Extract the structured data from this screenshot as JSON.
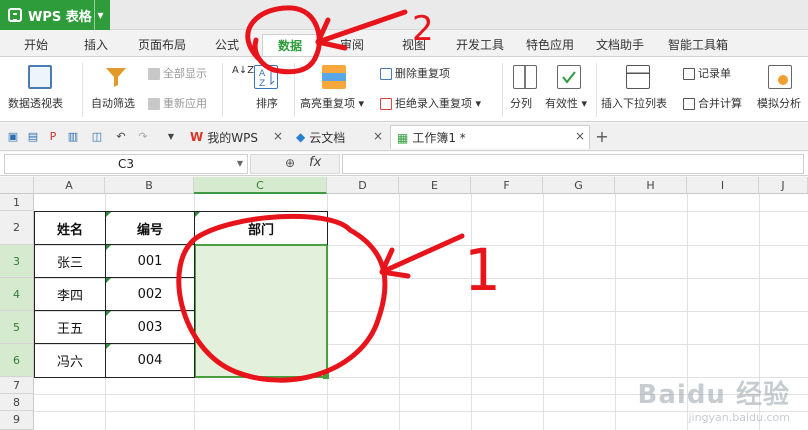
{
  "app": {
    "title": "WPS 表格",
    "brand_color": "#2f9c3c"
  },
  "ribbon_tabs": [
    {
      "label": "开始"
    },
    {
      "label": "插入"
    },
    {
      "label": "页面布局"
    },
    {
      "label": "公式"
    },
    {
      "label": "数据",
      "active": true
    },
    {
      "label": "审阅"
    },
    {
      "label": "视图"
    },
    {
      "label": "开发工具"
    },
    {
      "label": "特色应用"
    },
    {
      "label": "文档助手"
    },
    {
      "label": "智能工具箱"
    }
  ],
  "ribbon": {
    "pivot_table": "数据透视表",
    "auto_filter": "自动筛选",
    "show_all": "全部显示",
    "reapply": "重新应用",
    "sort_az": "A↓Z",
    "sort": "排序",
    "highlight_dup": "高亮重复项",
    "remove_dup": "删除重复项",
    "reject_dup": "拒绝录入重复项",
    "split": "分列",
    "validity": "有效性",
    "insert_dropdown": "插入下拉列表",
    "record_list": "记录单",
    "merge_calc": "合并计算",
    "simulate": "模拟分析"
  },
  "doc_tabs": [
    {
      "label": "我的WPS",
      "icon": "wps-w-icon"
    },
    {
      "label": "云文档",
      "icon": "cloud-doc-icon"
    },
    {
      "label": "工作簿1 *",
      "icon": "sheet-icon",
      "active": true
    }
  ],
  "formula_bar": {
    "name_box": "C3",
    "fx_label": "fx"
  },
  "columns": [
    "A",
    "B",
    "C",
    "D",
    "E",
    "F",
    "G",
    "H",
    "I",
    "J"
  ],
  "rows": [
    "1",
    "2",
    "3",
    "4",
    "5",
    "6",
    "7",
    "8",
    "9"
  ],
  "selected_col": "C",
  "selected_rows": [
    "3",
    "4",
    "5",
    "6"
  ],
  "table": {
    "headers": [
      "姓名",
      "编号",
      "部门"
    ],
    "rows": [
      [
        "张三",
        "001",
        ""
      ],
      [
        "李四",
        "002",
        ""
      ],
      [
        "王五",
        "003",
        ""
      ],
      [
        "冯六",
        "004",
        ""
      ]
    ]
  },
  "annotations": {
    "step1": "1",
    "step2": "2",
    "color": "#e8141b"
  },
  "watermark": {
    "main": "Baidu 经验",
    "sub": "jingyan.baidu.com"
  }
}
